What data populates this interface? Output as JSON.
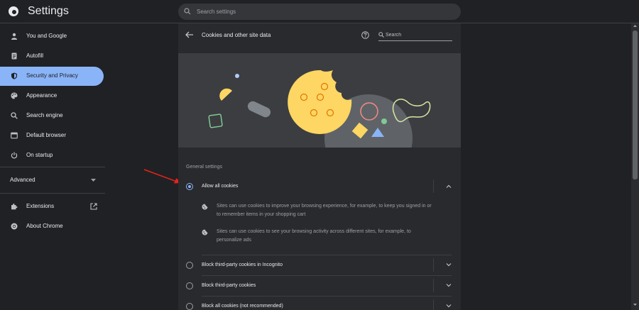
{
  "header": {
    "title": "Settings",
    "search_placeholder": "Search settings"
  },
  "sidebar": {
    "items": [
      {
        "label": "You and Google",
        "icon": "person-icon"
      },
      {
        "label": "Autofill",
        "icon": "clipboard-icon"
      },
      {
        "label": "Security and Privacy",
        "icon": "shield-icon",
        "active": true
      },
      {
        "label": "Appearance",
        "icon": "palette-icon"
      },
      {
        "label": "Search engine",
        "icon": "search-icon"
      },
      {
        "label": "Default browser",
        "icon": "browser-window-icon"
      },
      {
        "label": "On startup",
        "icon": "power-icon"
      }
    ],
    "advanced_label": "Advanced",
    "extensions_label": "Extensions",
    "about_label": "About Chrome"
  },
  "page": {
    "title": "Cookies and other site data",
    "search_placeholder": "Search",
    "section_title": "General settings",
    "options": [
      {
        "label": "Allow all cookies",
        "selected": true,
        "expanded": true
      },
      {
        "label": "Block third-party cookies in Incognito",
        "selected": false,
        "expanded": false
      },
      {
        "label": "Block third-party cookies",
        "selected": false,
        "expanded": false
      },
      {
        "label": "Block all cookies (not recommended)",
        "selected": false,
        "expanded": false
      }
    ],
    "allow_details": [
      {
        "line1": "Sites can use cookies to improve your browsing experience, for example, to keep you signed in or",
        "line2": "to remember items in your shopping cart"
      },
      {
        "line1": "Sites can use cookies to see your browsing activity across different sites, for example, to",
        "line2": "personalize ads"
      }
    ]
  },
  "colors": {
    "background": "#202124",
    "card": "#292a2d",
    "accent": "#8ab4f8",
    "cookie": "#fdd663",
    "annotation_arrow": "#e8221b"
  }
}
